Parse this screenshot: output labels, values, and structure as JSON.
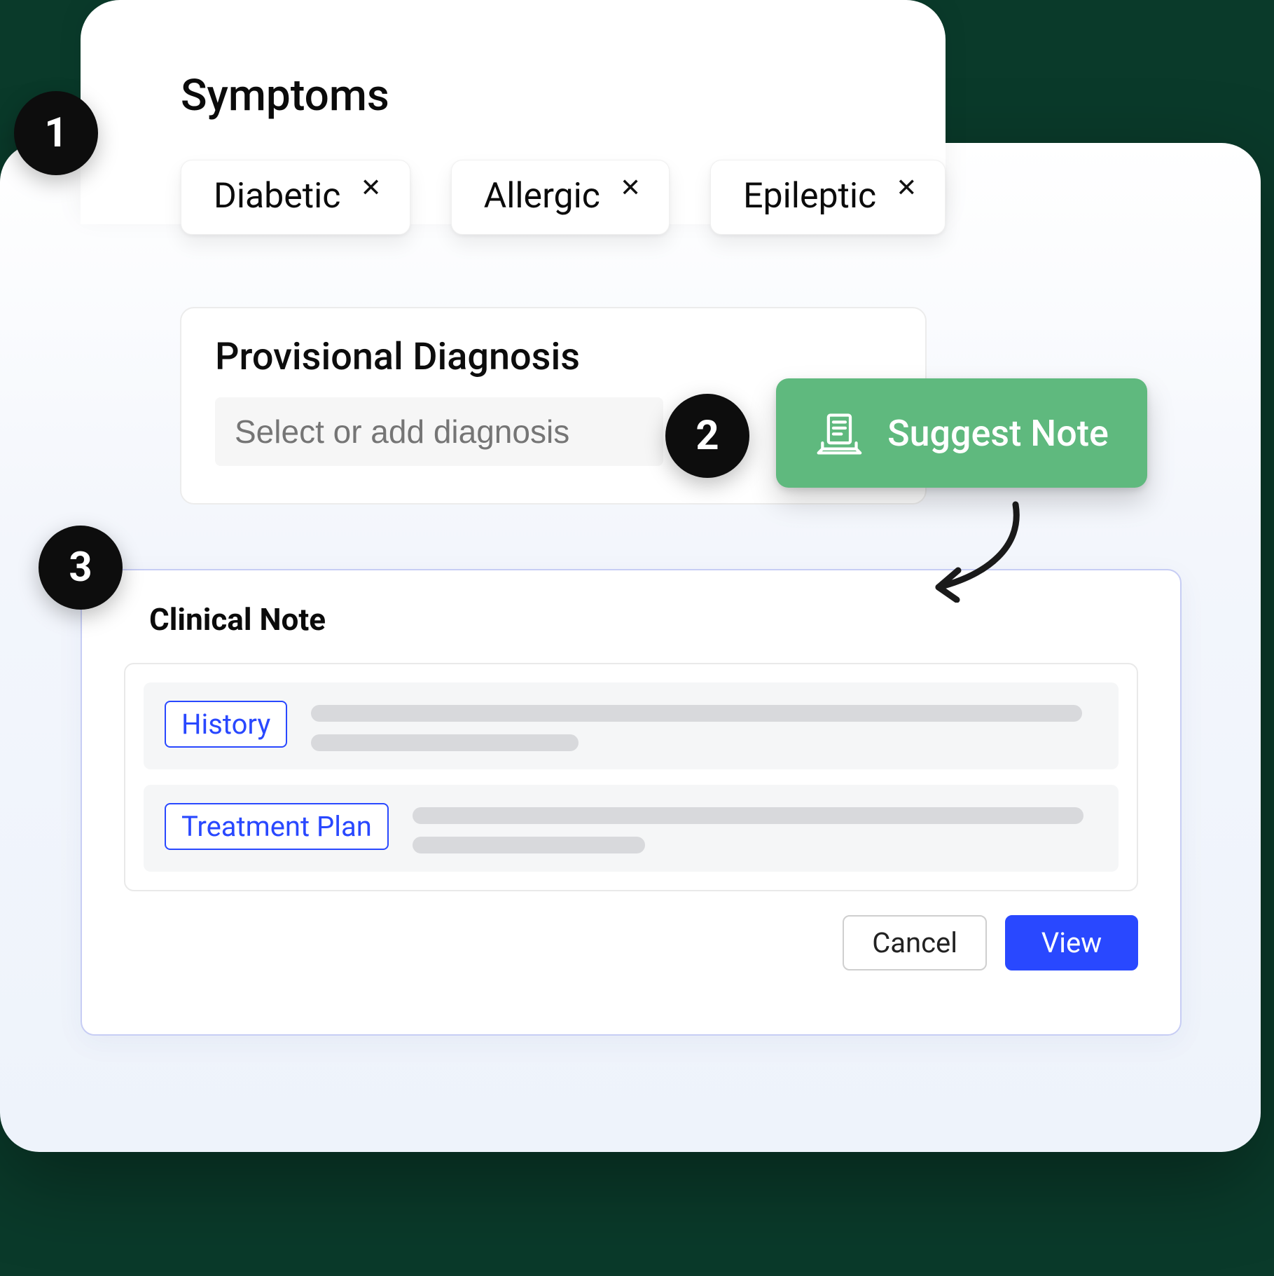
{
  "steps": {
    "one": "1",
    "two": "2",
    "three": "3"
  },
  "symptoms": {
    "title": "Symptoms",
    "chips": [
      {
        "label": "Diabetic"
      },
      {
        "label": "Allergic"
      },
      {
        "label": "Epileptic"
      }
    ]
  },
  "diagnosis": {
    "title": "Provisional Diagnosis",
    "placeholder": "Select or add diagnosis"
  },
  "suggest_button": {
    "label": "Suggest Note"
  },
  "clinical_note": {
    "title": "Clinical Note",
    "rows": [
      {
        "tag": "History"
      },
      {
        "tag": "Treatment Plan"
      }
    ],
    "cancel": "Cancel",
    "view": "View"
  }
}
